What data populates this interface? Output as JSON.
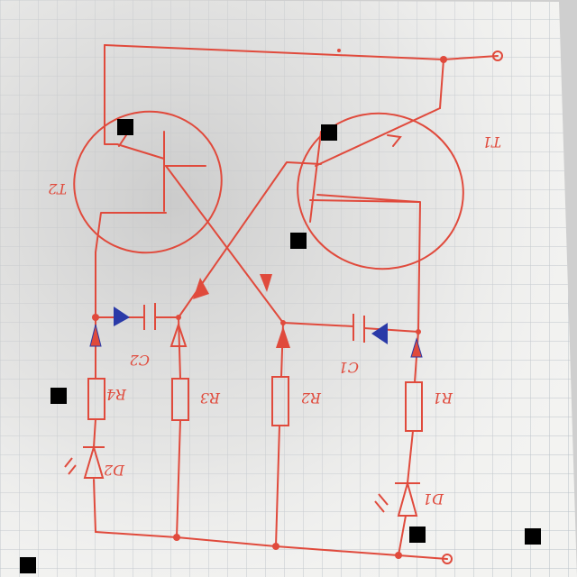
{
  "labels": {
    "transistor_left": "T2",
    "transistor_right": "T1",
    "resistor_1": "R1",
    "resistor_2": "R2",
    "resistor_3": "R3",
    "resistor_4": "R4",
    "capacitor_1": "C1",
    "capacitor_2": "C2",
    "diode_1": "D1",
    "diode_2": "D2"
  },
  "colors": {
    "ink": "#e04a3c",
    "arrow_red": "#e04a3c",
    "arrow_blue": "#2a3aa8",
    "grid": "#b9c0c7",
    "paper": "#f3f3f1",
    "shadow": "#c9c9c9"
  }
}
